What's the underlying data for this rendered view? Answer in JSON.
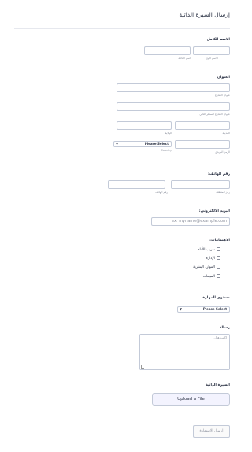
{
  "form": {
    "title": "إرسال السيرة الذاتية",
    "full_name": {
      "label": "الاسم الكامل",
      "first_sub": "الاسم الأول",
      "last_sub": "اسم العائلة"
    },
    "address": {
      "label": "العنوان",
      "street_sub": "عنوان الشارع",
      "street2_sub": "عنوان الشارع السطر الثاني",
      "city_sub": "المدينة",
      "state_sub": "الولاية",
      "zip_sub": "الرمز البريدي",
      "country_value": "Please Select",
      "country_sub": "Country"
    },
    "phone": {
      "label": "رقم الهاتف:",
      "area_sub": "رمز المنطقة",
      "number_sub": "رقم الهاتف",
      "separator": "-"
    },
    "email": {
      "label": "البريد الالكتروني:",
      "placeholder": "ex: myname@example.com"
    },
    "interests": {
      "label": "الاهتمامات:",
      "options": [
        "تدريب الأداء",
        "الإدارة",
        "الموارد البشرية",
        "المبيعات"
      ]
    },
    "skill": {
      "label": "مستوى المهارة",
      "value": "Please Select"
    },
    "message": {
      "label": "رسالة",
      "placeholder": "اكتب هنا..."
    },
    "resume": {
      "label": "السيرة الذاتية",
      "button": "Upload a File"
    },
    "submit": {
      "label": "إرسال الاستمارة"
    }
  }
}
